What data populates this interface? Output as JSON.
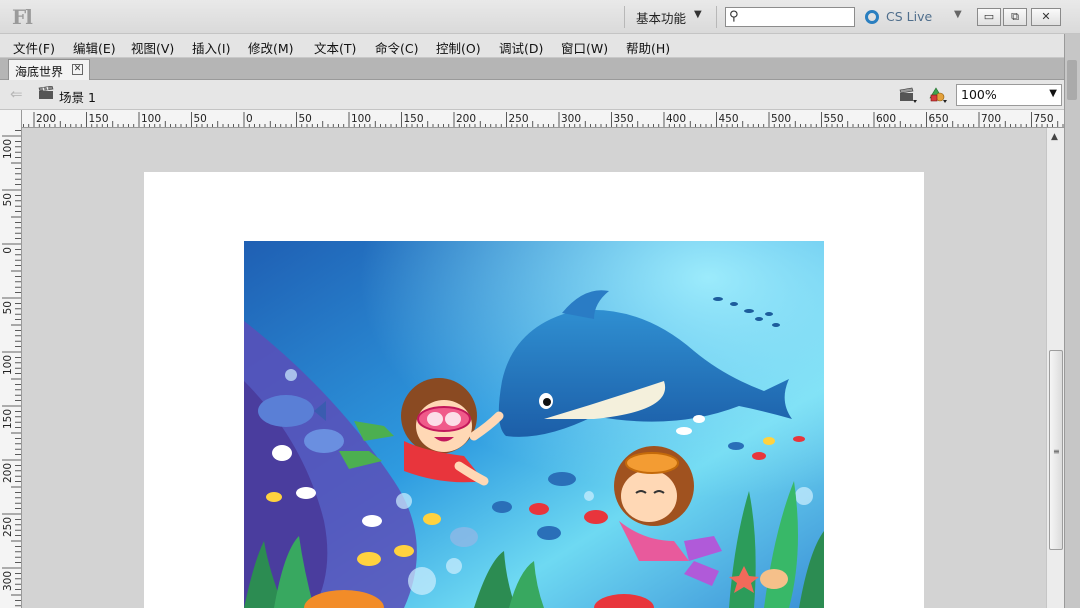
{
  "titlebar": {
    "app_logo": "Fl",
    "workspace": "基本功能",
    "search_placeholder": "",
    "cs_live": "CS Live"
  },
  "menu": [
    "文件(F)",
    "编辑(E)",
    "视图(V)",
    "插入(I)",
    "修改(M)",
    "文本(T)",
    "命令(C)",
    "控制(O)",
    "调试(D)",
    "窗口(W)",
    "帮助(H)"
  ],
  "document": {
    "tab_title": "海底世界",
    "scene_label": "场景 1",
    "zoom": "100%"
  },
  "ruler": {
    "horizontal_labels": [
      "200",
      "150",
      "100",
      "50",
      "0",
      "50",
      "100",
      "150",
      "200",
      "250",
      "300",
      "350",
      "400",
      "450",
      "500",
      "550",
      "600",
      "650",
      "700",
      "750"
    ],
    "vertical_labels": [
      "100",
      "50",
      "0",
      "50",
      "100",
      "150",
      "200",
      "250",
      "300"
    ]
  },
  "colors": {
    "accent": "#2a7fc0",
    "stage": "#ffffff",
    "pasteboard": "#d3d3d3"
  }
}
